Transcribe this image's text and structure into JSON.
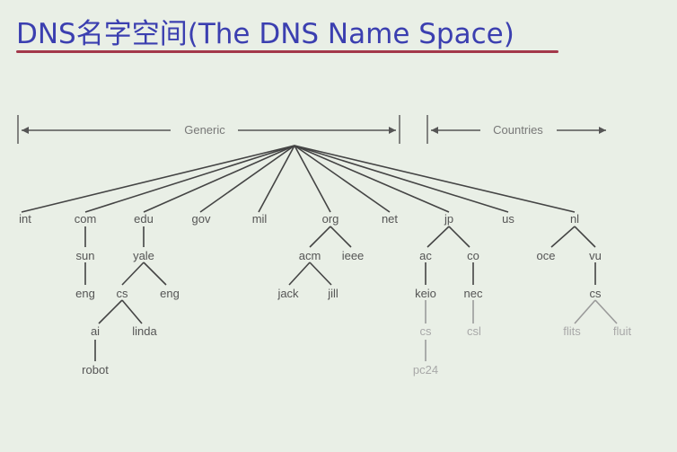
{
  "title": "DNS名字空间(The DNS Name Space)",
  "ranges": {
    "generic": "Generic",
    "countries": "Countries"
  },
  "nodes": {
    "int": "int",
    "com": "com",
    "edu": "edu",
    "gov": "gov",
    "mil": "mil",
    "org": "org",
    "net": "net",
    "jp": "jp",
    "us": "us",
    "nl": "nl",
    "sun": "sun",
    "yale": "yale",
    "acm": "acm",
    "ieee": "ieee",
    "ac": "ac",
    "co": "co",
    "oce": "oce",
    "vu": "vu",
    "eng_sun": "eng",
    "cs_yale": "cs",
    "eng_yale": "eng",
    "jack": "jack",
    "jill": "jill",
    "keio": "keio",
    "nec": "nec",
    "cs_vu": "cs",
    "ai": "ai",
    "linda": "linda",
    "cs_keio": "cs",
    "csl": "csl",
    "flits": "flits",
    "fluit": "fluit",
    "robot": "robot",
    "pc24": "pc24"
  }
}
